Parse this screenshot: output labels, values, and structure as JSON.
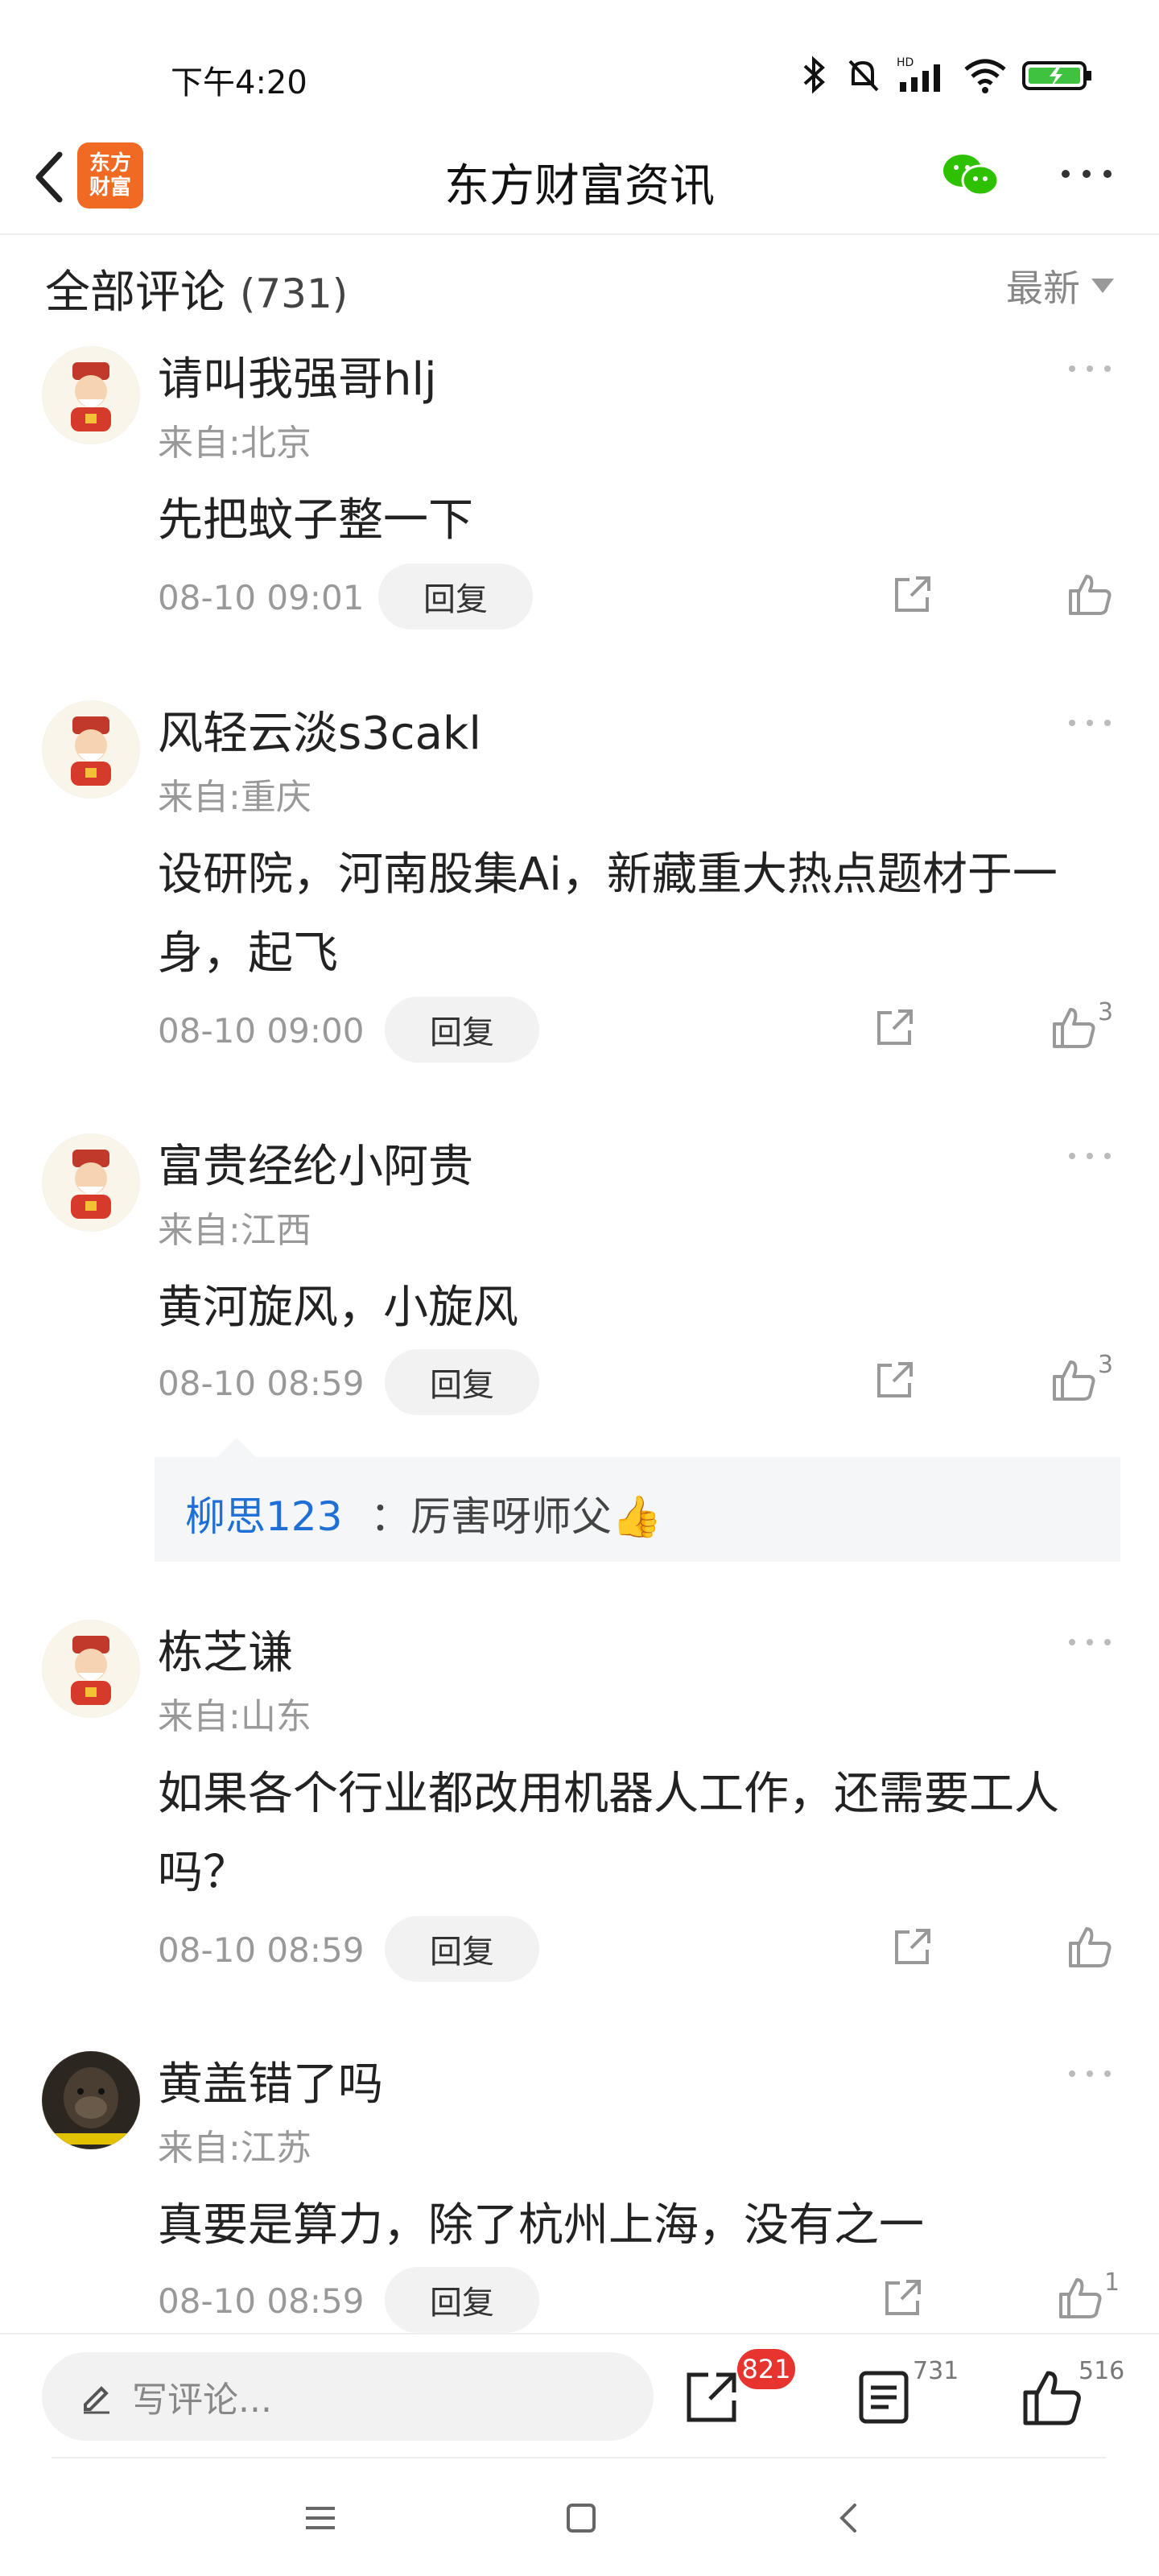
{
  "status_bar": {
    "time": "下午4:20"
  },
  "header": {
    "title": "东方财富资讯",
    "logo_line1": "东方",
    "logo_line2": "财富"
  },
  "comments_header": {
    "label": "全部评论",
    "count": "(731)",
    "sort": "最新"
  },
  "comments": [
    {
      "name": "请叫我强哥hlj",
      "location": "来自:北京",
      "content": "先把蚊子整一下",
      "time": "08-10 09:01",
      "reply_label": "回复",
      "likes": ""
    },
    {
      "name": "风轻云淡s3cakl",
      "location": "来自:重庆",
      "content": "设研院，河南股集Ai，新藏重大热点题材于一身，起飞",
      "time": "08-10 09:00",
      "reply_label": "回复",
      "likes": "3"
    },
    {
      "name": "富贵经纶小阿贵",
      "location": "来自:江西",
      "content": "黄河旋风，小旋风",
      "time": "08-10 08:59",
      "reply_label": "回复",
      "likes": "3",
      "sub_reply": {
        "user": "柳思123",
        "text": "：厉害呀师父👍"
      }
    },
    {
      "name": "栋芝谦",
      "location": "来自:山东",
      "content": "如果各个行业都改用机器人工作，还需要工人吗？",
      "time": "08-10 08:59",
      "reply_label": "回复",
      "likes": ""
    },
    {
      "name": "黄盖错了吗",
      "location": "来自:江苏",
      "content": "真要是算力，除了杭州上海，没有之一",
      "time": "08-10 08:59",
      "reply_label": "回复",
      "likes": "1"
    }
  ],
  "bottom_bar": {
    "placeholder": "写评论...",
    "share_count": "821",
    "comment_count": "731",
    "like_count": "516"
  },
  "colors": {
    "brand": "#f06a24",
    "link": "#1e6fd6",
    "badge": "#e8342e",
    "wechat": "#2dc100"
  }
}
